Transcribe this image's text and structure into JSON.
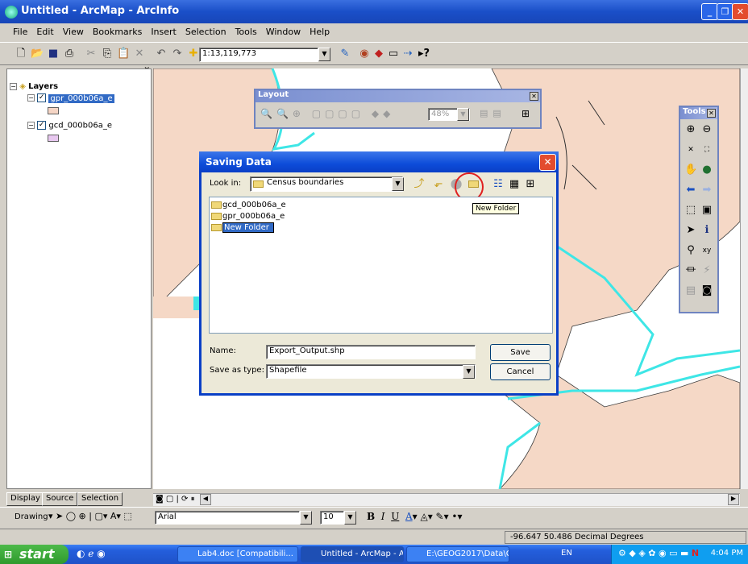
{
  "window": {
    "title": "Untitled - ArcMap - ArcInfo"
  },
  "menu": [
    "File",
    "Edit",
    "View",
    "Bookmarks",
    "Insert",
    "Selection",
    "Tools",
    "Window",
    "Help"
  ],
  "toolbar": {
    "scale": "1:13,119,773"
  },
  "toc": {
    "root": "Layers",
    "layers": [
      {
        "name": "gpr_000b06a_e",
        "selected": true,
        "color": "#f5d5c5"
      },
      {
        "name": "gcd_000b06a_e",
        "selected": false,
        "color": "#e8c8f0"
      }
    ],
    "tabs": [
      "Display",
      "Source",
      "Selection"
    ]
  },
  "layout_toolbar": {
    "title": "Layout",
    "zoom": "48%"
  },
  "tools_toolbar": {
    "title": "Tools"
  },
  "dialog": {
    "title": "Saving Data",
    "look_in_label": "Look in:",
    "look_in_value": "Census boundaries",
    "tooltip": "New Folder",
    "files": [
      "gcd_000b06a_e",
      "gpr_000b06a_e"
    ],
    "new_folder": "New Folder",
    "name_label": "Name:",
    "name_value": "Export_Output.shp",
    "type_label": "Save as type:",
    "type_value": "Shapefile",
    "save": "Save",
    "cancel": "Cancel"
  },
  "drawing": {
    "label": "Drawing",
    "font": "Arial",
    "size": "10"
  },
  "status": {
    "coords": "-96.647  50.486 Decimal Degrees"
  },
  "taskbar": {
    "start": "start",
    "tasks": [
      "Lab4.doc [Compatibili...",
      "Untitled - ArcMap - Ar...",
      "E:\\GEOG2017\\Data\\G..."
    ],
    "lang": "EN",
    "time": "4:04 PM"
  },
  "colors": {
    "land": "#f5d8c6",
    "boundary": "#3ee6e6",
    "titlebar": "#1a4fc8"
  }
}
